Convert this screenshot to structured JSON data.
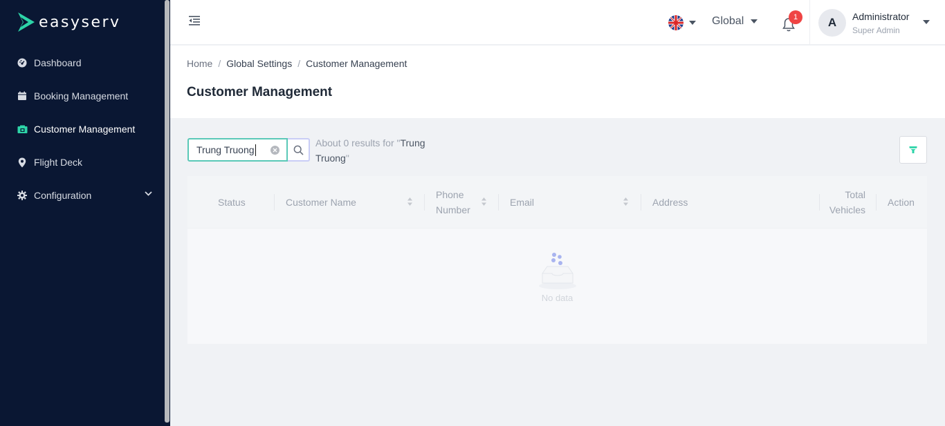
{
  "brand": {
    "name_a": "easy",
    "name_b": "serv"
  },
  "sidebar": {
    "items": [
      {
        "label": "Dashboard",
        "icon": "dashboard-icon"
      },
      {
        "label": "Booking Management",
        "icon": "calendar-icon"
      },
      {
        "label": "Customer Management",
        "icon": "id-card-icon",
        "active": true
      },
      {
        "label": "Flight Deck",
        "icon": "location-pin-icon"
      },
      {
        "label": "Configuration",
        "icon": "gear-icon",
        "expandable": true
      }
    ]
  },
  "topbar": {
    "language_icon": "uk-flag-icon",
    "region": "Global",
    "notifications_count": "1",
    "user": {
      "initial": "A",
      "name": "Administrator",
      "role": "Super Admin"
    }
  },
  "breadcrumb": [
    "Home",
    "Global Settings",
    "Customer Management"
  ],
  "page": {
    "title": "Customer Management"
  },
  "search": {
    "value": "Trung Truong",
    "results_prefix": "About 0 results for \"",
    "results_query": "Trung Truong",
    "results_suffix": "\""
  },
  "table": {
    "columns": [
      {
        "line1": "Status",
        "line2": ""
      },
      {
        "line1": "Customer Name",
        "line2": ""
      },
      {
        "line1": "Phone",
        "line2": "Number"
      },
      {
        "line1": "Email",
        "line2": ""
      },
      {
        "line1": "Address",
        "line2": ""
      },
      {
        "line1": "Total",
        "line2": "Vehicles"
      },
      {
        "line1": "Action",
        "line2": ""
      }
    ],
    "empty_text": "No data"
  },
  "colors": {
    "sidebar_bg": "#0a1733",
    "accent": "#2dd4a8",
    "badge": "#ef4444"
  }
}
